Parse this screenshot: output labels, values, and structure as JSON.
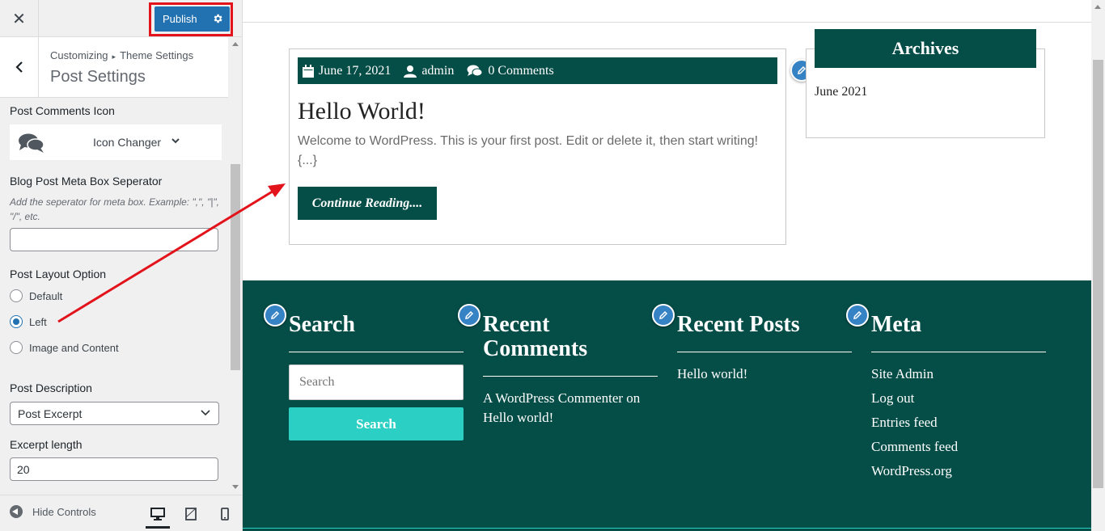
{
  "sidebar": {
    "publish_label": "Publish",
    "breadcrumb": {
      "parent": "Customizing",
      "section": "Theme Settings"
    },
    "panel_title": "Post Settings",
    "post_comments_icon": {
      "title": "Post Comments Icon",
      "changer_label": "Icon Changer"
    },
    "meta_separator": {
      "title": "Blog Post Meta Box Seperator",
      "description": "Add the seperator for meta box. Example: \",\", \"|\", \"/\", etc.",
      "value": ""
    },
    "layout": {
      "title": "Post Layout Option",
      "options": [
        "Default",
        "Left",
        "Image and Content"
      ],
      "selected": "Left"
    },
    "description": {
      "title": "Post Description",
      "selected": "Post Excerpt"
    },
    "excerpt": {
      "title": "Excerpt length",
      "value": "20"
    },
    "hide_controls_label": "Hide Controls"
  },
  "preview": {
    "post": {
      "date": "June 17, 2021",
      "author": "admin",
      "comments": "0 Comments",
      "title": "Hello World!",
      "excerpt": "Welcome to WordPress. This is your first post. Edit or delete it, then start writing! {...}",
      "continue_label": "Continue Reading...."
    },
    "archives": {
      "title": "Archives",
      "items": [
        "June 2021"
      ]
    },
    "footer": {
      "search": {
        "title": "Search",
        "placeholder": "Search",
        "button": "Search"
      },
      "recent_comments": {
        "title": "Recent Comments",
        "items": [
          "A WordPress Commenter on Hello world!"
        ]
      },
      "recent_posts": {
        "title": "Recent Posts",
        "items": [
          "Hello world!"
        ]
      },
      "meta": {
        "title": "Meta",
        "items": [
          "Site Admin",
          "Log out",
          "Entries feed",
          "Comments feed",
          "WordPress.org"
        ]
      }
    }
  },
  "colors": {
    "brand_green": "#054d47",
    "accent_teal": "#2ccfc4",
    "wp_blue": "#2271b1",
    "highlight_red": "#e3131b"
  },
  "icons": [
    "close-icon",
    "gear-icon",
    "chevron-left-icon",
    "comments-icon",
    "chevron-down-icon",
    "calendar-icon",
    "user-icon",
    "pencil-icon",
    "desktop-icon",
    "tablet-icon",
    "mobile-icon"
  ]
}
